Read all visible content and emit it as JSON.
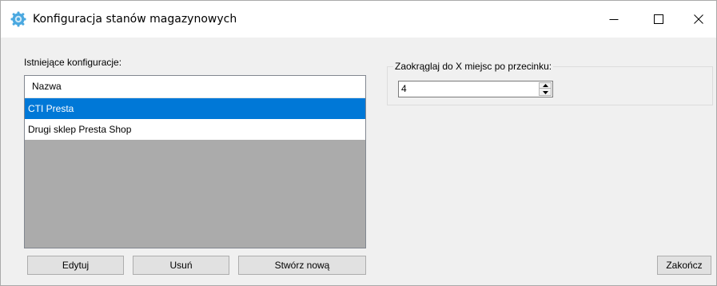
{
  "window": {
    "title": "Konfiguracja stanów magazynowych",
    "icon": "gear-cog-icon"
  },
  "configs": {
    "label": "Istniejące konfiguracje:",
    "column_header": "Nazwa",
    "rows": [
      {
        "name": "CTI Presta",
        "selected": true
      },
      {
        "name": "Drugi sklep Presta Shop",
        "selected": false
      }
    ],
    "buttons": {
      "edit": "Edytuj",
      "delete": "Usuń",
      "create": "Stwórz nową"
    }
  },
  "rounding": {
    "group_label": "Zaokrąglaj do X miejsc po przecinku:",
    "value": "4"
  },
  "footer": {
    "finish": "Zakończ"
  },
  "colors": {
    "selection": "#0078d7",
    "list_background": "#ababab",
    "window_background": "#f0f0f0"
  }
}
